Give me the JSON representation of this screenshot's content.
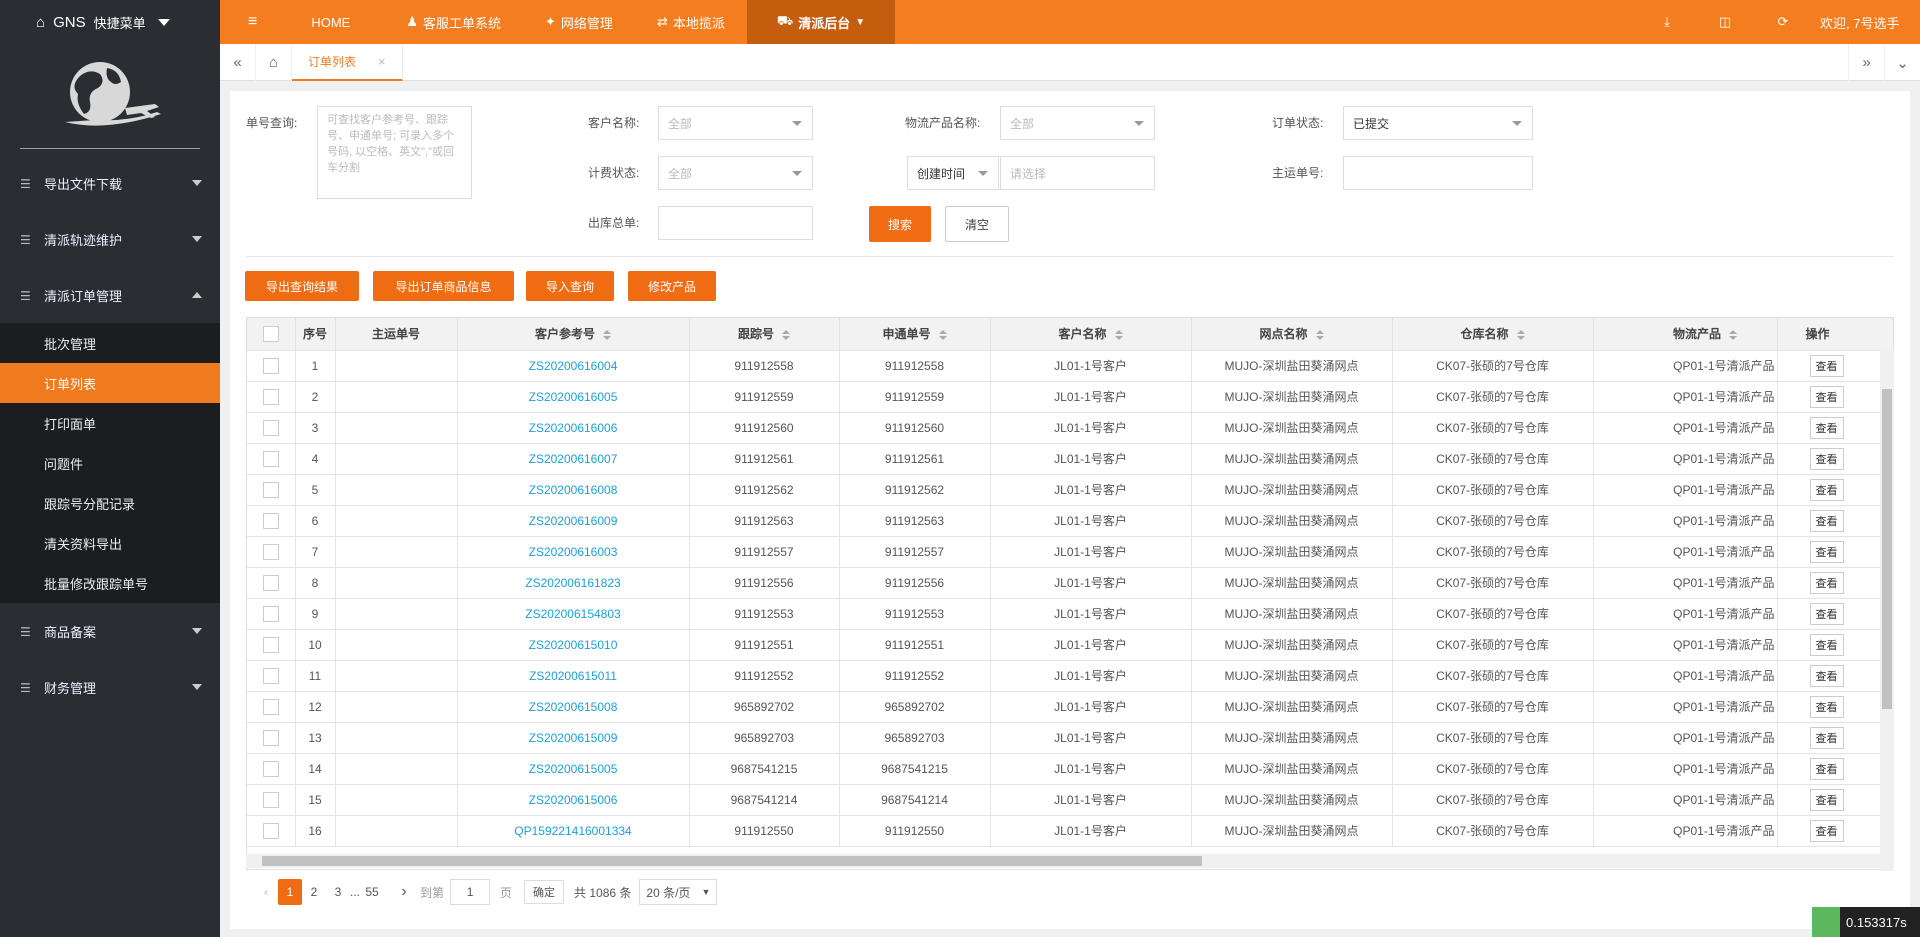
{
  "brand": {
    "name": "GNS",
    "quick_menu": "快捷菜单"
  },
  "sidebar": {
    "items": [
      {
        "label": "导出文件下载",
        "expanded": false
      },
      {
        "label": "清派轨迹维护",
        "expanded": false
      },
      {
        "label": "清派订单管理",
        "expanded": true
      },
      {
        "label": "商品备案",
        "expanded": false
      },
      {
        "label": "财务管理",
        "expanded": false
      }
    ],
    "submenu": [
      "批次管理",
      "订单列表",
      "打印面单",
      "问题件",
      "跟踪号分配记录",
      "清关资料导出",
      "批量修改跟踪单号"
    ],
    "active_sub": "订单列表"
  },
  "topnav": {
    "items": [
      "HOME",
      "客服工单系统",
      "网络管理",
      "本地揽派",
      "清派后台"
    ],
    "active": "清派后台",
    "welcome": "欢迎, 7号选手"
  },
  "tabs": {
    "current": "订单列表"
  },
  "filters": {
    "order_query_label": "单号查询:",
    "order_query_placeholder": "可查找客户参考号、跟踪号、申通单号; 可录入多个号码, 以空格、英文\",\"或回车分割",
    "customer_label": "客户名称:",
    "customer_value": "全部",
    "product_label": "物流产品名称:",
    "product_value": "全部",
    "status_label": "订单状态:",
    "status_value": "已提交",
    "billing_label": "计费状态:",
    "billing_value": "全部",
    "time_type": "创建时间",
    "time_placeholder": "请选择",
    "master_label": "主运单号:",
    "outbound_label": "出库总单:",
    "search_btn": "搜索",
    "clear_btn": "清空"
  },
  "actions": [
    "导出查询结果",
    "导出订单商品信息",
    "导入查询",
    "修改产品"
  ],
  "table": {
    "headers": [
      "序号",
      "主运单号",
      "客户参考号",
      "跟踪号",
      "申通单号",
      "客户名称",
      "网点名称",
      "仓库名称",
      "物流产品",
      "操作"
    ],
    "view_label": "查看",
    "rows": [
      [
        "1",
        "",
        "ZS20200616004",
        "911912558",
        "911912558",
        "JL01-1号客户",
        "MUJO-深圳盐田葵涌网点",
        "CK07-张硕的7号仓库",
        "QP01-1号清派产品"
      ],
      [
        "2",
        "",
        "ZS20200616005",
        "911912559",
        "911912559",
        "JL01-1号客户",
        "MUJO-深圳盐田葵涌网点",
        "CK07-张硕的7号仓库",
        "QP01-1号清派产品"
      ],
      [
        "3",
        "",
        "ZS20200616006",
        "911912560",
        "911912560",
        "JL01-1号客户",
        "MUJO-深圳盐田葵涌网点",
        "CK07-张硕的7号仓库",
        "QP01-1号清派产品"
      ],
      [
        "4",
        "",
        "ZS20200616007",
        "911912561",
        "911912561",
        "JL01-1号客户",
        "MUJO-深圳盐田葵涌网点",
        "CK07-张硕的7号仓库",
        "QP01-1号清派产品"
      ],
      [
        "5",
        "",
        "ZS20200616008",
        "911912562",
        "911912562",
        "JL01-1号客户",
        "MUJO-深圳盐田葵涌网点",
        "CK07-张硕的7号仓库",
        "QP01-1号清派产品"
      ],
      [
        "6",
        "",
        "ZS20200616009",
        "911912563",
        "911912563",
        "JL01-1号客户",
        "MUJO-深圳盐田葵涌网点",
        "CK07-张硕的7号仓库",
        "QP01-1号清派产品"
      ],
      [
        "7",
        "",
        "ZS20200616003",
        "911912557",
        "911912557",
        "JL01-1号客户",
        "MUJO-深圳盐田葵涌网点",
        "CK07-张硕的7号仓库",
        "QP01-1号清派产品"
      ],
      [
        "8",
        "",
        "ZS202006161823",
        "911912556",
        "911912556",
        "JL01-1号客户",
        "MUJO-深圳盐田葵涌网点",
        "CK07-张硕的7号仓库",
        "QP01-1号清派产品"
      ],
      [
        "9",
        "",
        "ZS202006154803",
        "911912553",
        "911912553",
        "JL01-1号客户",
        "MUJO-深圳盐田葵涌网点",
        "CK07-张硕的7号仓库",
        "QP01-1号清派产品"
      ],
      [
        "10",
        "",
        "ZS20200615010",
        "911912551",
        "911912551",
        "JL01-1号客户",
        "MUJO-深圳盐田葵涌网点",
        "CK07-张硕的7号仓库",
        "QP01-1号清派产品"
      ],
      [
        "11",
        "",
        "ZS20200615011",
        "911912552",
        "911912552",
        "JL01-1号客户",
        "MUJO-深圳盐田葵涌网点",
        "CK07-张硕的7号仓库",
        "QP01-1号清派产品"
      ],
      [
        "12",
        "",
        "ZS20200615008",
        "965892702",
        "965892702",
        "JL01-1号客户",
        "MUJO-深圳盐田葵涌网点",
        "CK07-张硕的7号仓库",
        "QP01-1号清派产品"
      ],
      [
        "13",
        "",
        "ZS20200615009",
        "965892703",
        "965892703",
        "JL01-1号客户",
        "MUJO-深圳盐田葵涌网点",
        "CK07-张硕的7号仓库",
        "QP01-1号清派产品"
      ],
      [
        "14",
        "",
        "ZS20200615005",
        "9687541215",
        "9687541215",
        "JL01-1号客户",
        "MUJO-深圳盐田葵涌网点",
        "CK07-张硕的7号仓库",
        "QP01-1号清派产品"
      ],
      [
        "15",
        "",
        "ZS20200615006",
        "9687541214",
        "9687541214",
        "JL01-1号客户",
        "MUJO-深圳盐田葵涌网点",
        "CK07-张硕的7号仓库",
        "QP01-1号清派产品"
      ],
      [
        "16",
        "",
        "QP159221416001334",
        "911912550",
        "911912550",
        "JL01-1号客户",
        "MUJO-深圳盐田葵涌网点",
        "CK07-张硕的7号仓库",
        "QP01-1号清派产品"
      ]
    ]
  },
  "pagination": {
    "pages": [
      "1",
      "2",
      "3",
      "...",
      "55"
    ],
    "current": "1",
    "goto_label": "到第",
    "goto_value": "1",
    "page_unit": "页",
    "confirm": "确定",
    "total": "共 1086 条",
    "page_size": "20 条/页"
  },
  "timer": "0.153317s",
  "colors": {
    "accent": "#f47d20",
    "sidebar": "#2a2e33",
    "link": "#1e9fd8"
  }
}
